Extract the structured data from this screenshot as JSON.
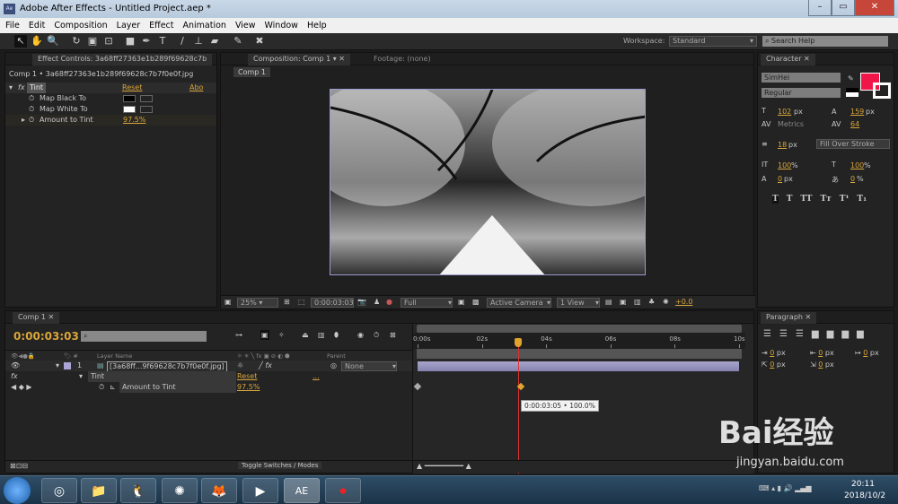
{
  "window": {
    "title": "Adobe After Effects - Untitled Project.aep *",
    "app_icon": "Ae"
  },
  "menu": [
    "File",
    "Edit",
    "Composition",
    "Layer",
    "Effect",
    "Animation",
    "View",
    "Window",
    "Help"
  ],
  "toolbar": {
    "workspace_label": "Workspace:",
    "workspace_value": "Standard",
    "search_placeholder": "Search Help"
  },
  "effect_controls": {
    "tab": "Effect Controls: 3a68ff27363e1b289f69628c7b",
    "breadcrumb": "Comp 1 • 3a68ff27363e1b289f69628c7b7f0e0f.jpg",
    "effect": "Tint",
    "reset": "Reset",
    "about": "Abo",
    "props": [
      {
        "label": "Map Black To",
        "color": "#000000"
      },
      {
        "label": "Map White To",
        "color": "#ffffff"
      },
      {
        "label": "Amount to Tint",
        "value": "97.5%"
      }
    ]
  },
  "composition": {
    "tab": "Composition: Comp 1",
    "footage_tab": "Footage: (none)",
    "subtab": "Comp 1",
    "zoom": "25%",
    "timecode": "0:00:03:03",
    "resolution": "Full",
    "camera": "Active Camera",
    "views": "1 View",
    "exposure": "+0.0"
  },
  "character": {
    "tab": "Character",
    "font": "SimHei",
    "style": "Regular",
    "fill_color": "#f0164a",
    "size": "102",
    "size_unit": "px",
    "leading": "159",
    "leading_unit": "px",
    "kerning": "Metrics",
    "tracking": "64",
    "stroke_width": "18",
    "stroke_unit": "px",
    "stroke_mode": "Fill Over Stroke",
    "vscale": "100",
    "vscale_unit": "%",
    "hscale": "100",
    "hscale_unit": "%",
    "baseline": "0",
    "baseline_unit": "px",
    "tsume": "0",
    "tsume_unit": "%",
    "styles": [
      "T",
      "T",
      "TT",
      "Tт",
      "T¹",
      "T₁"
    ]
  },
  "paragraph": {
    "tab": "Paragraph",
    "indents": [
      {
        "value": "0",
        "unit": "px"
      },
      {
        "value": "0",
        "unit": "px"
      },
      {
        "value": "0",
        "unit": "px"
      },
      {
        "value": "0",
        "unit": "px"
      },
      {
        "value": "0",
        "unit": "px"
      }
    ]
  },
  "timeline": {
    "tab": "Comp 1",
    "timecode": "0:00:03:03",
    "col_layer_name": "Layer Name",
    "col_parent": "Parent",
    "layer_num": "1",
    "layer_name": "[3a68ff...9f69628c7b7f0e0f.jpg]",
    "parent": "None",
    "effect": "Tint",
    "reset": "Reset",
    "ellipsis": "...",
    "prop": "Amount to Tint",
    "prop_value": "97.5%",
    "ruler": [
      "0:00s",
      "02s",
      "04s",
      "06s",
      "08s",
      "10s"
    ],
    "playhead_seconds": 3.13,
    "duration_seconds": 10,
    "keyframes_seconds": [
      0,
      3.21
    ],
    "tooltip": "0:00:03:05 • 100.0%",
    "toggle_label": "Toggle Switches / Modes",
    "label_color": "#a9a3d6"
  },
  "taskbar": {
    "time": "20:11",
    "date": "2018/10/2"
  },
  "watermark": {
    "text": "Bai经验",
    "url": "jingyan.baidu.com"
  }
}
